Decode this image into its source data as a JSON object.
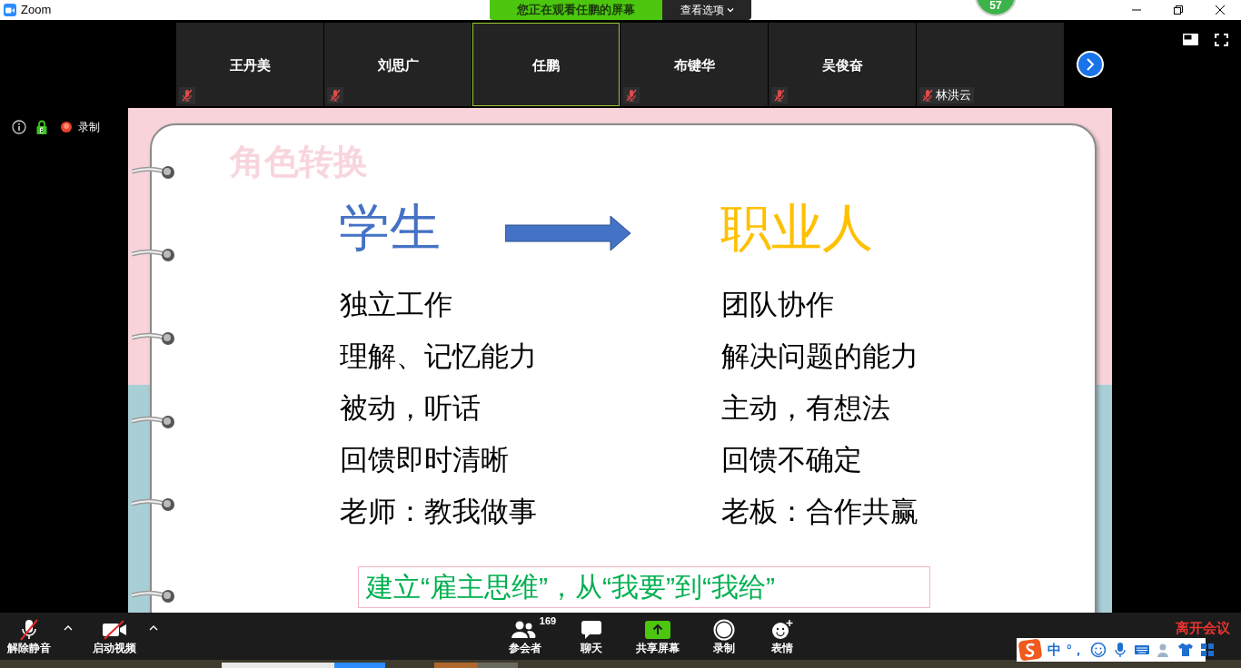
{
  "window": {
    "title": "Zoom"
  },
  "share_banner": {
    "text": "您正在观看任鹏的屏幕",
    "view_options": "查看选项"
  },
  "badge": "57",
  "participants": [
    {
      "name": "王丹美",
      "selected": false,
      "muted": true,
      "kind": "center"
    },
    {
      "name": "刘思广",
      "selected": false,
      "muted": true,
      "kind": "center"
    },
    {
      "name": "任鹏",
      "selected": true,
      "muted": false,
      "kind": "center"
    },
    {
      "name": "布键华",
      "selected": false,
      "muted": true,
      "kind": "center"
    },
    {
      "name": "吴俊奋",
      "selected": false,
      "muted": true,
      "kind": "center"
    },
    {
      "name": "林洪云",
      "selected": false,
      "muted": true,
      "kind": "label"
    }
  ],
  "meeting_info": {
    "recording": "录制"
  },
  "slide": {
    "title": "角色转换",
    "left_heading": "学生",
    "right_heading": "职业人",
    "left_items": [
      "独立工作",
      "理解、记忆能力",
      "被动，听话",
      "回馈即时清晰",
      "老师：教我做事"
    ],
    "right_items": [
      "团队协作",
      "解决问题的能力",
      "主动，有想法",
      "回馈不确定",
      "老板：合作共赢"
    ],
    "footer": "建立“雇主思维”，从“我要”到“我给”"
  },
  "toolbar": {
    "left": [
      {
        "kind": "mic",
        "label": "解除静音"
      },
      {
        "kind": "video",
        "label": "启动视频"
      }
    ],
    "center": [
      {
        "kind": "participants",
        "label": "参会者",
        "count": "169"
      },
      {
        "kind": "chat",
        "label": "聊天"
      },
      {
        "kind": "share",
        "label": "共享屏幕"
      },
      {
        "kind": "record",
        "label": "录制"
      },
      {
        "kind": "reactions",
        "label": "表情"
      }
    ],
    "leave": "离开会议"
  },
  "ime": {
    "mode": "中",
    "punct": "°，"
  }
}
